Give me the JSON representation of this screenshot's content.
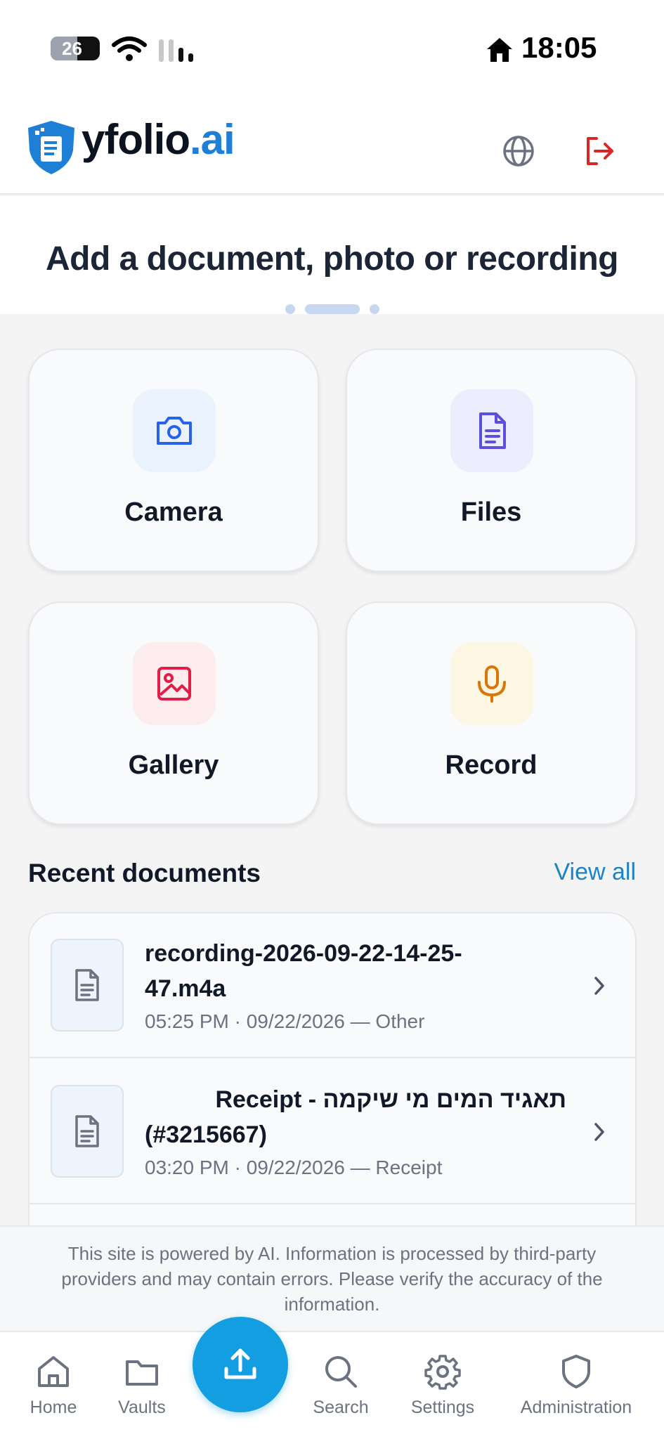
{
  "status_bar": {
    "battery_level": "26",
    "time": "18:05"
  },
  "header": {
    "logo_main": "yfolio",
    "logo_suffix": ".ai",
    "icons": [
      "globe-icon",
      "logout-icon"
    ]
  },
  "hero": {
    "title": "Add a document, photo or recording",
    "pager_count": 3,
    "pager_active": 1
  },
  "actions": [
    {
      "label": "Camera",
      "icon": "camera-icon",
      "icon_color": "#2563eb",
      "icon_bg": "#eaf2fe"
    },
    {
      "label": "Files",
      "icon": "file-icon",
      "icon_color": "#5b4fe0",
      "icon_bg": "#ecedfd"
    },
    {
      "label": "Gallery",
      "icon": "image-icon",
      "icon_color": "#e11d48",
      "icon_bg": "#fdecee"
    },
    {
      "label": "Record",
      "icon": "microphone-icon",
      "icon_color": "#d97706",
      "icon_bg": "#fdf6e3"
    }
  ],
  "recent": {
    "title": "Recent documents",
    "view_all": "View all",
    "documents": [
      {
        "name_line1": "recording-2026-09-22-14-25-",
        "name_line2": "47.m4a",
        "meta": "05:25 PM · 09/22/2026 — Other"
      },
      {
        "name_line1": "תאגיד המים מי שיקמה - Receipt",
        "name_line2": "(#3215667)",
        "meta": "03:20 PM · 09/22/2026 — Receipt"
      }
    ]
  },
  "notice": {
    "text": "This site is powered by AI. Information is processed by third-party providers and may contain errors. Please verify the accuracy of the information."
  },
  "nav": {
    "home": "Home",
    "vaults": "Vaults",
    "search": "Search",
    "settings": "Settings",
    "administration": "Administration"
  },
  "colors": {
    "accent": "#129ee0",
    "brand_blue": "#1d7fd6",
    "logout_red": "#dc2626",
    "link": "#1d83c7"
  }
}
